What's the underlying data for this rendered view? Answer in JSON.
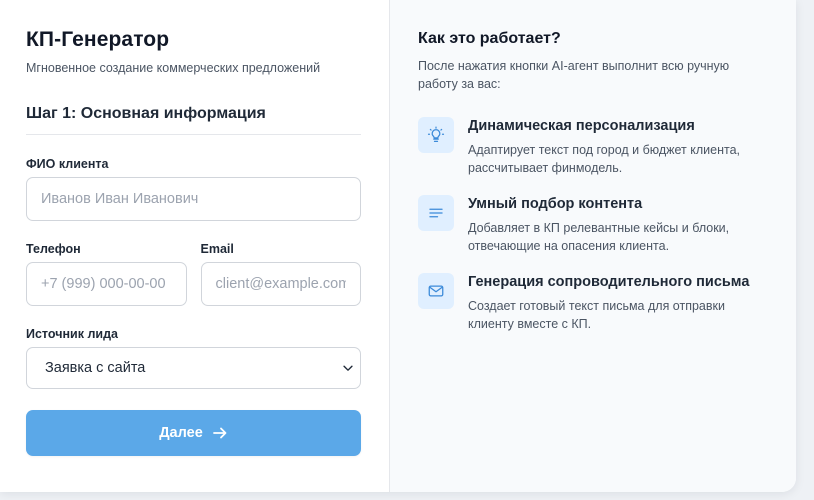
{
  "header": {
    "title": "КП-Генератор",
    "subtitle": "Мгновенное создание коммерческих предложений"
  },
  "step": {
    "title": "Шаг 1: Основная информация"
  },
  "form": {
    "name": {
      "label": "ФИО клиента",
      "placeholder": "Иванов Иван Иванович",
      "value": ""
    },
    "phone": {
      "label": "Телефон",
      "placeholder": "+7 (999) 000-00-00",
      "value": ""
    },
    "email": {
      "label": "Email",
      "placeholder": "client@example.com",
      "value": ""
    },
    "source": {
      "label": "Источник лида",
      "selected": "Заявка с сайта"
    },
    "submit_label": "Далее"
  },
  "how": {
    "title": "Как это работает?",
    "description": "После нажатия кнопки AI-агент выполнит всю ручную работу за вас:",
    "features": [
      {
        "icon": "lightbulb-icon",
        "title": "Динамическая персонализация",
        "text": "Адаптирует текст под город и бюджет клиента, рассчитывает финмодель."
      },
      {
        "icon": "lines-icon",
        "title": "Умный подбор контента",
        "text": "Добавляет в КП релевантные кейсы и блоки, отвечающие на опасения клиента."
      },
      {
        "icon": "mail-icon",
        "title": "Генерация сопроводительного письма",
        "text": "Создает готовый текст письма для отправки клиенту вместе с КП."
      }
    ]
  },
  "colors": {
    "accent": "#5ba8e8",
    "icon": "#3b8ad9",
    "icon_bg": "#e0efff"
  }
}
